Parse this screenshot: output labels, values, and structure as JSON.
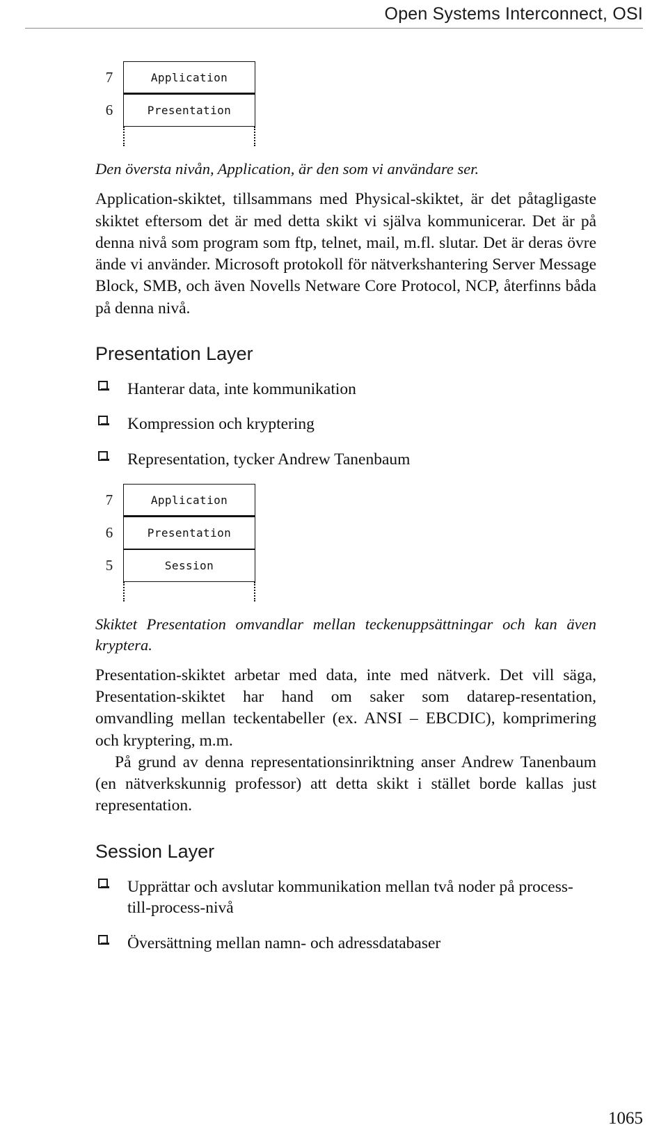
{
  "header": {
    "title": "Open Systems Interconnect, OSI"
  },
  "figure1": {
    "name": "osi-stack-application-presentation",
    "rows": [
      {
        "number": "7",
        "label": "Application"
      },
      {
        "number": "6",
        "label": "Presentation"
      }
    ]
  },
  "figure2": {
    "name": "osi-stack-application-presentation-session",
    "rows": [
      {
        "number": "7",
        "label": "Application"
      },
      {
        "number": "6",
        "label": "Presentation"
      },
      {
        "number": "5",
        "label": "Session"
      }
    ]
  },
  "caption1": "Den översta nivån, Application, är den som vi användare ser.",
  "paragraph1": "Application-skiktet, tillsammans med Physical-skiktet, är det påtagligaste skiktet eftersom det är med detta skikt vi själva kommunicerar. Det är på denna nivå som program som ftp, telnet, mail, m.fl. slutar. Det är deras övre ände vi använder. Microsoft protokoll för nätverkshantering Server Message Block, SMB, och även Novells Netware Core Protocol, NCP, återfinns båda på denna nivå.",
  "presentation_section": {
    "heading": "Presentation Layer",
    "bullets": [
      "Hanterar data, inte kommunikation",
      "Kompression och kryptering",
      "Representation, tycker Andrew Tanenbaum"
    ]
  },
  "caption2": "Skiktet Presentation omvandlar mellan teckenuppsättningar och kan även kryptera.",
  "paragraph2": "Presentation-skiktet arbetar med data, inte med nätverk. Det vill säga, Presentation-skiktet har hand om saker som datarep-resentation, omvandling mellan teckentabeller (ex. ANSI – EBCDIC), komprimering och kryptering, m.m.",
  "paragraph3": "På grund av denna representationsinriktning anser Andrew Tanenbaum (en nätverkskunnig professor) att detta skikt i stället borde kallas just representation.",
  "session_section": {
    "heading": "Session Layer",
    "bullets": [
      "Upprättar och avslutar kommunikation mellan två noder på process-till-process-nivå",
      "Översättning mellan namn- och adressdatabaser"
    ]
  },
  "folio": "1065"
}
